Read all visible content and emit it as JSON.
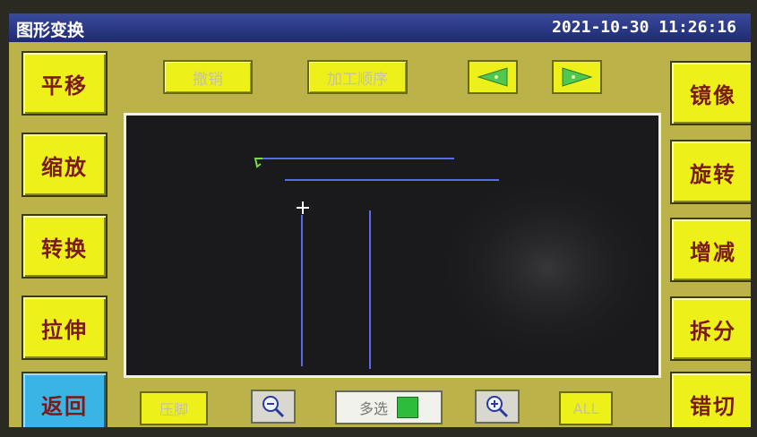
{
  "header": {
    "title": "图形变换",
    "datetime": "2021-10-30 11:26:16"
  },
  "left_buttons": [
    "平移",
    "缩放",
    "转换",
    "拉伸",
    "返回"
  ],
  "right_buttons": [
    "镜像",
    "旋转",
    "增减",
    "拆分",
    "错切"
  ],
  "top_buttons": {
    "undo": "撤销",
    "process_order": "加工顺序"
  },
  "arrows": {
    "prev": "left-arrow-icon",
    "next": "right-arrow-icon"
  },
  "bottom": {
    "presser_foot": "压脚",
    "multi_select": "多选",
    "all": "ALL",
    "multi_select_state": "on"
  },
  "icons": {
    "zoom_out": "zoom-out-icon",
    "zoom_in": "zoom-in-icon"
  },
  "colors": {
    "button_yellow": "#eef01a",
    "back_button": "#3ab4e4",
    "title_bar": "#1e2a72",
    "multi_select_indicator": "#2ebc3c",
    "pattern_lines": "#5a6ae8"
  }
}
